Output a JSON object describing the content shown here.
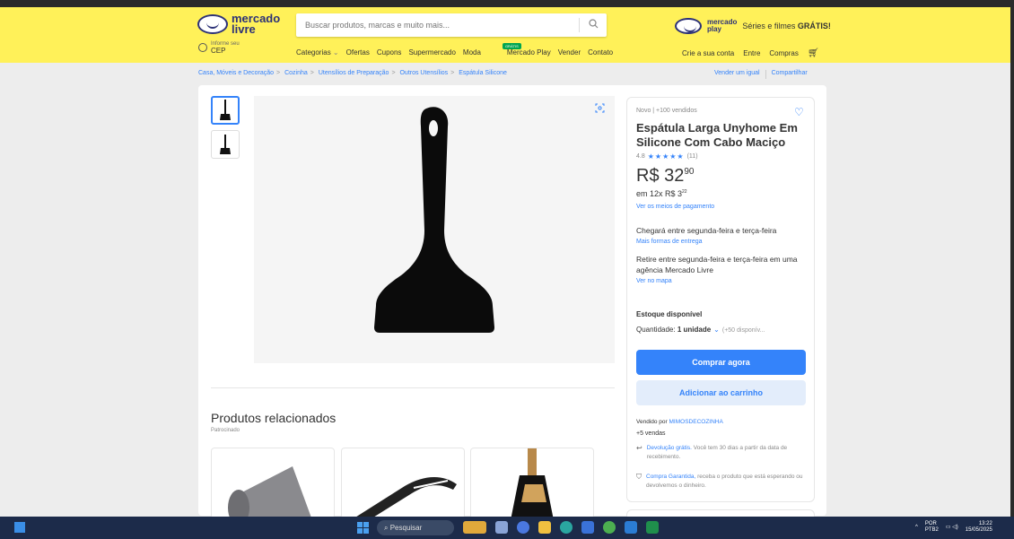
{
  "header": {
    "logo_line1": "mercado",
    "logo_line2": "livre",
    "search_placeholder": "Buscar produtos, marcas e muito mais...",
    "promo_logo1": "mercado",
    "promo_logo2": "play",
    "promo_text": "Séries e filmes ",
    "promo_bold": "GRÁTIS!",
    "location_small": "Informe seu",
    "location_big": "CEP",
    "nav": [
      "Categorias",
      "Ofertas",
      "Cupons",
      "Supermercado",
      "Moda",
      "Mercado Play",
      "Vender",
      "Contato"
    ],
    "nav_badge": "GRÁTIS",
    "user_nav": [
      "Crie a sua conta",
      "Entre",
      "Compras"
    ]
  },
  "breadcrumb": [
    "Casa, Móveis e Decoração",
    "Cozinha",
    "Utensílios de Preparação",
    "Outros Utensílios",
    "Espátula Silicone"
  ],
  "share": [
    "Vender um igual",
    "Compartilhar"
  ],
  "related": {
    "title": "Produtos relacionados",
    "subtitle": "Patrocinado"
  },
  "product": {
    "condition": "Novo  |  +100 vendidos",
    "title": "Espátula Larga Unyhome Em Silicone Com Cabo Maciço",
    "rating": "4.8",
    "stars": "★★★★★",
    "reviews": "(11)",
    "currency": "R$ ",
    "price_int": "32",
    "price_cents": "90",
    "installments_prefix": "em 12x R$ 3",
    "installments_cents": "22",
    "payment_link": "Ver os meios de pagamento",
    "delivery": "Chegará entre segunda-feira e terça-feira",
    "delivery_link": "Mais formas de entrega",
    "pickup": "Retire entre segunda-feira e terça-feira em uma agência Mercado Livre",
    "pickup_link": "Ver no mapa",
    "stock": "Estoque disponível",
    "qty_label": "Quantidade: ",
    "qty_value": "1 unidade",
    "qty_avail": "(+50 disponív...",
    "buy_label": "Comprar agora",
    "cart_label": "Adicionar ao carrinho",
    "seller_prefix": "Vendido por ",
    "seller_name": "MIMOSDECOZINHA",
    "sales": "+5 vendas",
    "return_link": "Devolução grátis.",
    "return_text": " Você tem 30 dias a partir da data de recebimento.",
    "guarantee_link": "Compra Garantida,",
    "guarantee_text": " receba o produto que está esperando ou devolvemos o dinheiro."
  },
  "taskbar": {
    "search": "Pesquisar",
    "lang1": "POR",
    "lang2": "PTB2",
    "time": "13:22",
    "date": "15/05/2025"
  },
  "colors": {
    "header": "#fff159",
    "accent": "#3483fa",
    "brand": "#2d3277"
  }
}
